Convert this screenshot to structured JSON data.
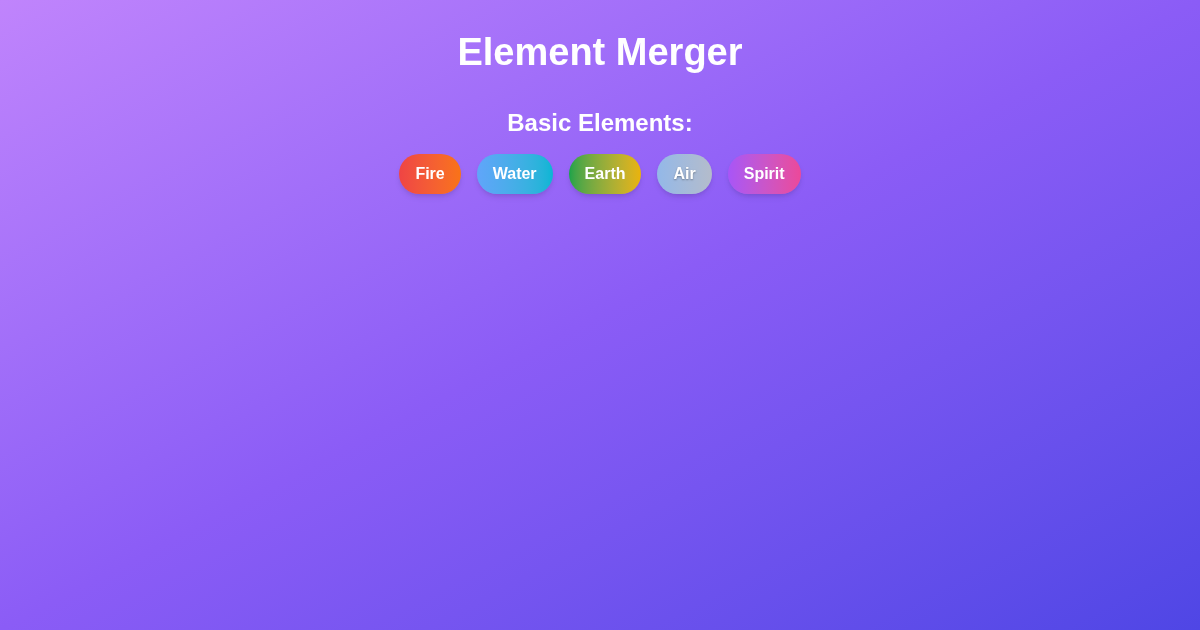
{
  "title": "Element Merger",
  "section": {
    "heading": "Basic Elements:",
    "elements": [
      {
        "label": "Fire",
        "kind": "fire"
      },
      {
        "label": "Water",
        "kind": "water"
      },
      {
        "label": "Earth",
        "kind": "earth"
      },
      {
        "label": "Air",
        "kind": "air"
      },
      {
        "label": "Spirit",
        "kind": "spirit"
      }
    ]
  }
}
